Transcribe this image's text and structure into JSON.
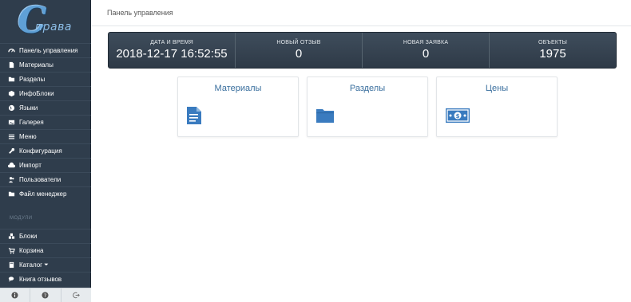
{
  "logo": {
    "letter": "C",
    "word": "права"
  },
  "sidebar": {
    "items": [
      {
        "label": "Панель управления",
        "icon": "dashboard-icon"
      },
      {
        "label": "Материалы",
        "icon": "file-icon"
      },
      {
        "label": "Разделы",
        "icon": "folder-icon"
      },
      {
        "label": "ИнфоБлоки",
        "icon": "cube-icon"
      },
      {
        "label": "Языки",
        "icon": "globe-icon"
      },
      {
        "label": "Галерея",
        "icon": "image-icon"
      },
      {
        "label": "Меню",
        "icon": "menu-icon"
      },
      {
        "label": "Конфигурация",
        "icon": "wrench-icon"
      },
      {
        "label": "Импорт",
        "icon": "cloud-upload-icon"
      },
      {
        "label": "Пользователи",
        "icon": "users-icon"
      },
      {
        "label": "Файл менеджер",
        "icon": "folder-icon"
      }
    ],
    "section_label": "МОДУЛИ",
    "modules": [
      {
        "label": "Блоки",
        "icon": "cubes-icon"
      },
      {
        "label": "Корзина",
        "icon": "cart-icon"
      },
      {
        "label": "Каталог",
        "icon": "book-icon",
        "has_caret": true,
        "caret": "⏷"
      },
      {
        "label": "Книга отзывов",
        "icon": "comments-icon"
      }
    ]
  },
  "header": {
    "title": "Панель управления"
  },
  "stats": [
    {
      "label": "ДАТА И ВРЕМЯ",
      "value": "2018-12-17 16:52:55"
    },
    {
      "label": "НОВЫЙ ОТЗЫВ",
      "value": "0"
    },
    {
      "label": "НОВАЯ ЗАЯВКА",
      "value": "0"
    },
    {
      "label": "ОБЪЕКТЫ",
      "value": "1975"
    }
  ],
  "cards": [
    {
      "title": "Материалы",
      "icon": "document-icon"
    },
    {
      "title": "Разделы",
      "icon": "folder-icon"
    },
    {
      "title": "Цены",
      "icon": "money-icon"
    }
  ],
  "colors": {
    "sidebar": "#2f3d4c",
    "accent": "#3a7bbf",
    "stats_bg": "#36434f"
  }
}
